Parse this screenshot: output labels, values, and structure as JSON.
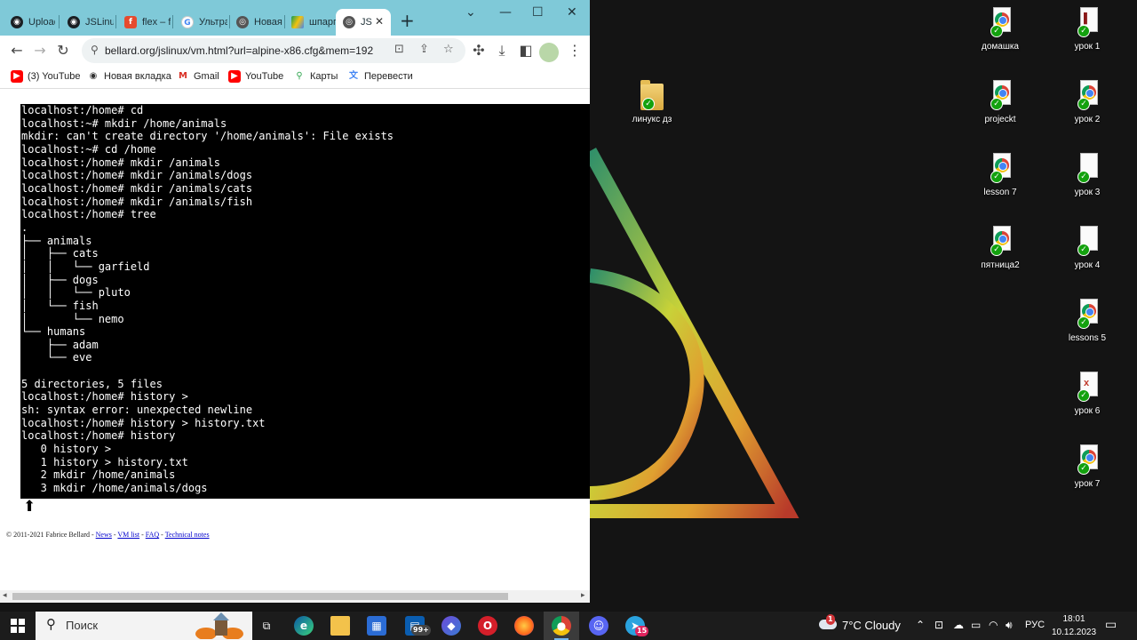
{
  "browser": {
    "tabs": [
      {
        "label": "Upload",
        "icon": "github-icon"
      },
      {
        "label": "JSLinux",
        "icon": "github-icon"
      },
      {
        "label": "flex – f",
        "icon": "figma-icon"
      },
      {
        "label": "Ультра",
        "icon": "google-icon"
      },
      {
        "label": "Новая",
        "icon": "chrome-icon"
      },
      {
        "label": "шпарг",
        "icon": "google-drive-icon"
      },
      {
        "label": "JS",
        "icon": "chrome-icon"
      }
    ],
    "url": "bellard.org/jslinux/vm.html?url=alpine-x86.cfg&mem=192",
    "bookmarks": [
      "(3) YouTube",
      "Новая вкладка",
      "Gmail",
      "YouTube",
      "Карты",
      "Перевести"
    ]
  },
  "terminal": {
    "lines": [
      "localhost:/home# cd",
      "localhost:~# mkdir /home/animals",
      "mkdir: can't create directory '/home/animals': File exists",
      "localhost:~# cd /home",
      "localhost:/home# mkdir /animals",
      "localhost:/home# mkdir /animals/dogs",
      "localhost:/home# mkdir /animals/cats",
      "localhost:/home# mkdir /animals/fish",
      "localhost:/home# tree",
      ".",
      "├── animals",
      "│   ├── cats",
      "│   │   └── garfield",
      "│   ├── dogs",
      "│   │   └── pluto",
      "│   └── fish",
      "│       └── nemo",
      "└── humans",
      "    ├── adam",
      "    └── eve",
      "",
      "5 directories, 5 files",
      "localhost:/home# history >",
      "sh: syntax error: unexpected newline",
      "localhost:/home# history > history.txt",
      "localhost:/home# history",
      "   0 history >",
      "   1 history > history.txt",
      "   2 mkdir /home/animals",
      "   3 mkdir /home/animals/dogs"
    ]
  },
  "footer": {
    "copyright": "© 2011-2021 Fabrice Bellard - ",
    "links": [
      "News",
      "VM list",
      "FAQ",
      "Technical notes"
    ],
    "sep": " - "
  },
  "desktop": {
    "icons": [
      {
        "label": "домашка",
        "type": "chrome-doc-icon"
      },
      {
        "label": "урок 1",
        "type": "doc-icon"
      },
      {
        "label": "projeckt",
        "type": "chrome-doc-icon"
      },
      {
        "label": "урок 2",
        "type": "chrome-doc-icon"
      },
      {
        "label": "lesson 7",
        "type": "chrome-doc-icon"
      },
      {
        "label": "урок 3",
        "type": "doc-icon"
      },
      {
        "label": "пятница2",
        "type": "chrome-doc-icon"
      },
      {
        "label": "урок 4",
        "type": "doc-icon"
      },
      {
        "label": "lessons 5",
        "type": "chrome-doc-icon"
      },
      {
        "label": "урок 6",
        "type": "excel-doc-icon"
      },
      {
        "label": "урок 7",
        "type": "chrome-doc-icon"
      },
      {
        "label": "линукс дз",
        "type": "folder-icon"
      }
    ]
  },
  "taskbar": {
    "search_placeholder": "Поиск",
    "badge_99": "99+",
    "badge_telegram": "15",
    "weather": "7°C  Cloudy",
    "weather_badge": "1",
    "language": "РУС",
    "time": "18:01",
    "date": "10.12.2023"
  },
  "colors": {
    "tabbar": "#7fc9d8",
    "terminal_bg": "#000000",
    "terminal_fg": "#ffffff",
    "desktop_bg": "#141414"
  }
}
